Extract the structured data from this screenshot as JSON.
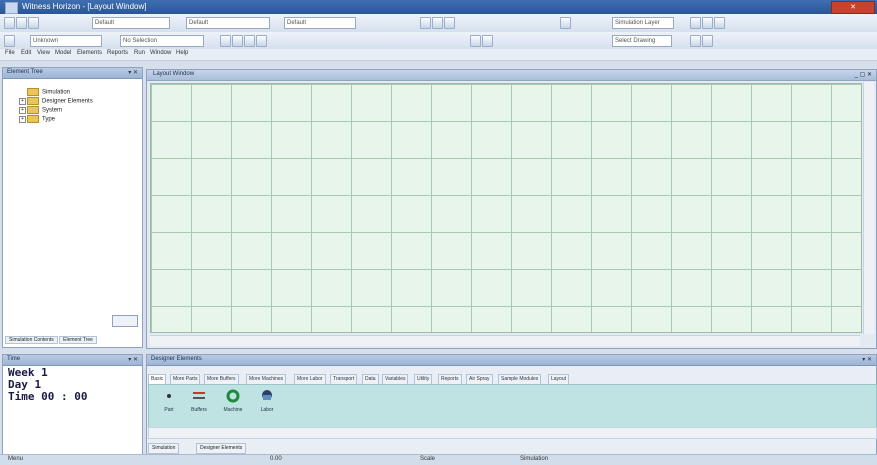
{
  "window": {
    "title": "Witness Horizon - [Layout Window]"
  },
  "toolbar1": {
    "combo_a": "Default",
    "combo_b": "Default",
    "combo_c": "Default",
    "combo_d": "Simulation Layer"
  },
  "toolbar2": {
    "combo_a": "Unknown",
    "combo_b": "No Selection",
    "combo_c": "Select Drawing"
  },
  "menu": [
    "File",
    "Edit",
    "View",
    "Model",
    "Elements",
    "Reports",
    "Run",
    "Window",
    "Help"
  ],
  "element_tree": {
    "title": "Element Tree",
    "items": [
      "Simulation",
      "Designer Elements",
      "System",
      "Type"
    ],
    "tab_simulation": "Simulation Contents",
    "tab_tree": "Element Tree"
  },
  "layout": {
    "title": "Layout Window"
  },
  "time_panel": {
    "title": "Time",
    "week": "Week  1",
    "day": "Day  1",
    "time": "Time  00 : 00"
  },
  "designer": {
    "title": "Designer Elements",
    "tabs": [
      "Basic",
      "More Parts",
      "More Buffers",
      "More Machines",
      "More Labor",
      "Transport",
      "Data",
      "Variables",
      "Utility",
      "Reports",
      "Air Spray",
      "Sample Modules",
      "Layout"
    ],
    "elements": [
      {
        "label": "Part"
      },
      {
        "label": "Buffers"
      },
      {
        "label": "Machine"
      },
      {
        "label": "Labor"
      }
    ],
    "bottom_tabs": [
      "Simulation",
      "Designer Elements"
    ]
  },
  "status": {
    "a": "Menu",
    "b": "0.00",
    "c": "Scale",
    "d": "Simulation"
  },
  "colors": {
    "title": "#2a5596",
    "grid_bg": "#e8f5ea",
    "elements_bg": "#bfe3e3"
  }
}
